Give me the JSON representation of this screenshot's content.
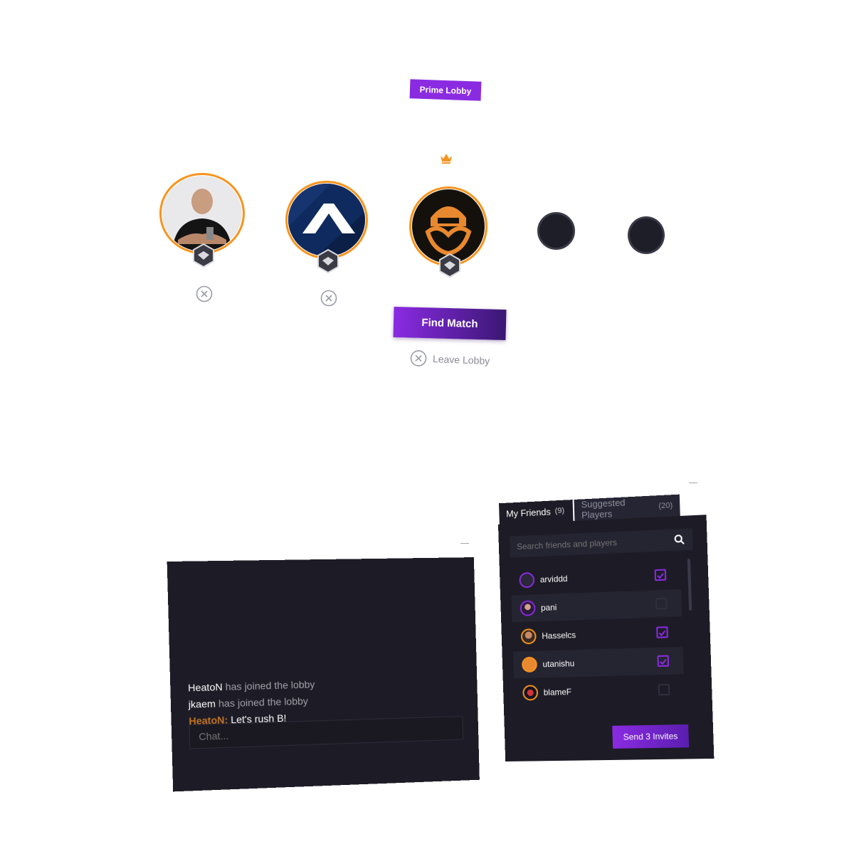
{
  "lobby": {
    "prime_label": "Prime Lobby",
    "find_match_label": "Find Match",
    "leave_label": "Leave Lobby",
    "members": [
      {
        "name": "player-photo",
        "leader": false
      },
      {
        "name": "team-logo-a",
        "leader": false
      },
      {
        "name": "ence-logo",
        "leader": true
      }
    ],
    "empty_slots": 2
  },
  "chat": {
    "messages": [
      {
        "user": "HeatoN",
        "text": "has joined the lobby",
        "type": "system"
      },
      {
        "user": "jkaem",
        "text": "has joined the lobby",
        "type": "system"
      },
      {
        "user": "HeatoN:",
        "text": "Let's rush B!",
        "type": "message"
      }
    ],
    "placeholder": "Chat..."
  },
  "friends": {
    "tabs": [
      {
        "label": "My Friends",
        "count": "(9)",
        "active": true
      },
      {
        "label": "Suggested Players",
        "count": "(20)",
        "active": false
      }
    ],
    "search_placeholder": "Search friends and players",
    "list": [
      {
        "name": "arviddd",
        "checked": true
      },
      {
        "name": "pani",
        "checked": false
      },
      {
        "name": "Hasselcs",
        "checked": true
      },
      {
        "name": "utanishu",
        "checked": true
      },
      {
        "name": "blameF",
        "checked": false
      }
    ],
    "send_label": "Send 3 Invites"
  },
  "colors": {
    "accent": "#8a2be2",
    "leader_orange": "#f7941d",
    "panel_bg": "#1d1c26"
  }
}
